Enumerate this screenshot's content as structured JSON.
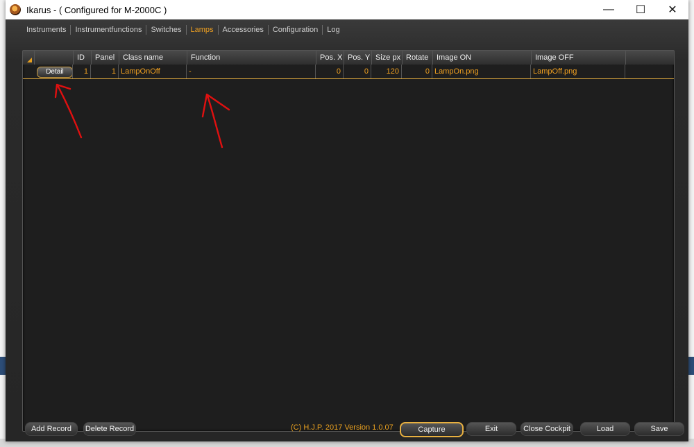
{
  "window": {
    "title": "Ikarus - ( Configured for M-2000C )",
    "controls": {
      "minimize": "—",
      "maximize": "☐",
      "close": "✕"
    }
  },
  "tabs": [
    {
      "label": "Instruments"
    },
    {
      "label": "Instrumentfunctions"
    },
    {
      "label": "Switches"
    },
    {
      "label": "Lamps",
      "active": true
    },
    {
      "label": "Accessories"
    },
    {
      "label": "Configuration"
    },
    {
      "label": "Log"
    }
  ],
  "grid": {
    "columns": {
      "detail": "",
      "id": "ID",
      "panel": "Panel",
      "class_name": "Class name",
      "function": "Function",
      "pos_x": "Pos. X",
      "pos_y": "Pos. Y",
      "size_px": "Size px",
      "rotate": "Rotate",
      "image_on": "Image ON",
      "image_off": "Image OFF"
    },
    "rows": [
      {
        "detail_label": "Detail",
        "id": "1",
        "panel": "1",
        "class_name": "LampOnOff",
        "function": "-",
        "pos_x": "0",
        "pos_y": "0",
        "size_px": "120",
        "rotate": "0",
        "image_on": "LampOn.png",
        "image_off": "LampOff.png"
      }
    ]
  },
  "footer": {
    "add_record": "Add Record",
    "delete_record": "Delete Record",
    "copyright": "(C) H.J.P. 2017  Version 1.0.07",
    "capture": "Capture",
    "exit": "Exit",
    "close_cockpit": "Close Cockpit",
    "load": "Load",
    "save": "Save"
  },
  "colors": {
    "accent": "#f0a020",
    "annotation": "#e01010",
    "background": "#2a2a2a"
  }
}
